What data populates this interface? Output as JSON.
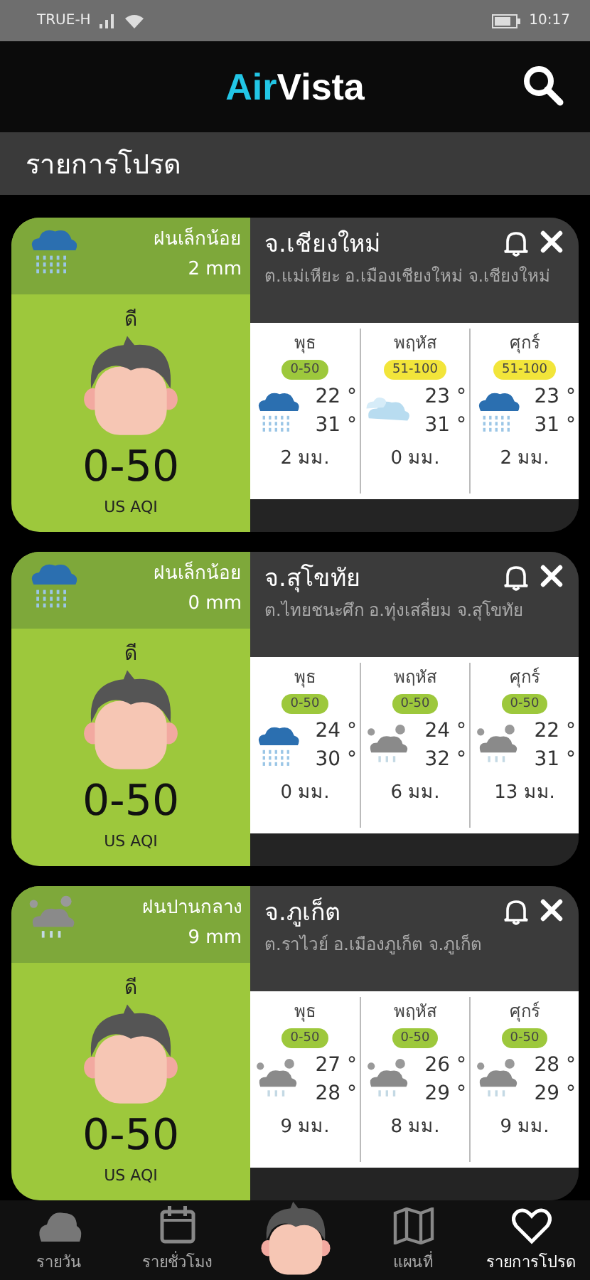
{
  "status_bar": {
    "carrier": "TRUE-H",
    "time": "10:17"
  },
  "app_bar": {
    "logo_first": "Air",
    "logo_second": "Vista"
  },
  "section_title": "รายการโปรด",
  "cards": [
    {
      "rain_label": "ฝนเล็กน้อย",
      "rain_amount": "2 mm",
      "kind": "rain",
      "quality": "ดี",
      "aqi": "0-50",
      "aqi_unit": "US AQI",
      "province": "จ.เชียงใหม่",
      "address": "ต.แม่เหียะ อ.เมืองเชียงใหม่ จ.เชียงใหม่",
      "forecast": [
        {
          "day": "พุธ",
          "aqi": "0-50",
          "color": "#9dc83c",
          "kind": "rain",
          "low": "22 °",
          "high": "31 °",
          "rain": "2 มม."
        },
        {
          "day": "พฤหัส",
          "aqi": "51-100",
          "color": "#f2e53a",
          "kind": "cloud",
          "low": "23 °",
          "high": "31 °",
          "rain": "0 มม."
        },
        {
          "day": "ศุกร์",
          "aqi": "51-100",
          "color": "#f2e53a",
          "kind": "rain",
          "low": "23 °",
          "high": "31 °",
          "rain": "2 มม."
        }
      ]
    },
    {
      "rain_label": "ฝนเล็กน้อย",
      "rain_amount": "0 mm",
      "kind": "rain",
      "quality": "ดี",
      "aqi": "0-50",
      "aqi_unit": "US AQI",
      "province": "จ.สุโขทัย",
      "address": "ต.ไทยชนะศึก อ.ทุ่งเสลี่ยม จ.สุโขทัย",
      "forecast": [
        {
          "day": "พุธ",
          "aqi": "0-50",
          "color": "#9dc83c",
          "kind": "rain",
          "low": "24 °",
          "high": "30 °",
          "rain": "0 มม."
        },
        {
          "day": "พฤหัส",
          "aqi": "0-50",
          "color": "#9dc83c",
          "kind": "showers",
          "low": "24 °",
          "high": "32 °",
          "rain": "6 มม."
        },
        {
          "day": "ศุกร์",
          "aqi": "0-50",
          "color": "#9dc83c",
          "kind": "showers",
          "low": "22 °",
          "high": "31 °",
          "rain": "13 มม."
        }
      ]
    },
    {
      "rain_label": "ฝนปานกลาง",
      "rain_amount": "9 mm",
      "kind": "showers",
      "quality": "ดี",
      "aqi": "0-50",
      "aqi_unit": "US AQI",
      "province": "จ.ภูเก็ต",
      "address": "ต.ราไวย์ อ.เมืองภูเก็ต จ.ภูเก็ต",
      "forecast": [
        {
          "day": "พุธ",
          "aqi": "0-50",
          "color": "#9dc83c",
          "kind": "showers",
          "low": "27 °",
          "high": "28 °",
          "rain": "9 มม."
        },
        {
          "day": "พฤหัส",
          "aqi": "0-50",
          "color": "#9dc83c",
          "kind": "showers",
          "low": "26 °",
          "high": "29 °",
          "rain": "8 มม."
        },
        {
          "day": "ศุกร์",
          "aqi": "0-50",
          "color": "#9dc83c",
          "kind": "showers",
          "low": "28 °",
          "high": "29 °",
          "rain": "9 มม."
        }
      ]
    }
  ],
  "bottom_nav": [
    {
      "label": "รายวัน",
      "kind": "cloud",
      "selected": false
    },
    {
      "label": "รายชั่วโมง",
      "kind": "calendar",
      "selected": false
    },
    {
      "label": "แผนที่",
      "kind": "map",
      "selected": false
    },
    {
      "label": "รายการโปรด",
      "kind": "heart",
      "selected": true
    }
  ]
}
